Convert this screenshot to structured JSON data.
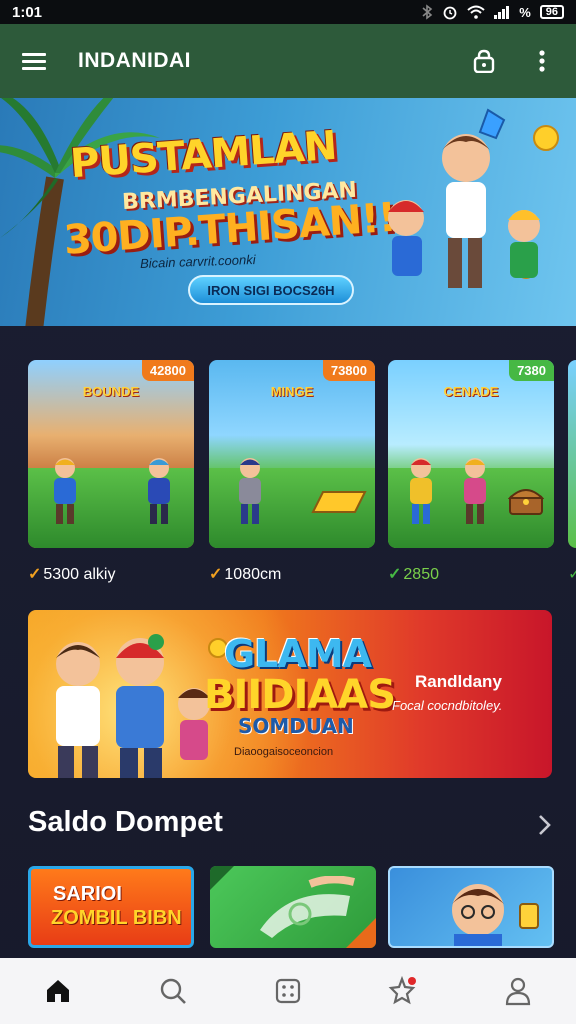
{
  "status_bar": {
    "time": "1:01",
    "battery_text": "96"
  },
  "app_bar": {
    "title": "INDANIDAI",
    "icons": [
      "menu-icon",
      "lock-icon",
      "more-vert-icon"
    ]
  },
  "hero_banner": {
    "headline_1": "PUSTAMLAN",
    "headline_2": "BRMBENGALINGAN",
    "headline_3": "30DIP.THISAN!!",
    "subtext": "Bicain carvrit.coonki",
    "cta_label": "IRON SIGI BOCS26H"
  },
  "game_cards": [
    {
      "badge": "42800",
      "mini_title": "BOUNDE",
      "price": "5300 alkiy",
      "badge_color": "#f07a1c",
      "check_color": "#f0a020"
    },
    {
      "badge": "73800",
      "mini_title": "MINGE",
      "price": "1080cm",
      "badge_color": "#f07a1c",
      "check_color": "#f0a020"
    },
    {
      "badge": "7380",
      "mini_title": "CENADE",
      "price": "2850",
      "badge_color": "#46b844",
      "check_color": "#46b844"
    }
  ],
  "promo_banner": {
    "line_1": "GLAMA",
    "line_2": "BIIDIAAS",
    "line_3": "SOMDUAN",
    "line_4": "Diaoogaisoceoncion",
    "right_title": "Randldany",
    "right_subtitle": "Focal cocndbitoley."
  },
  "section": {
    "title": "Saldo Dompet",
    "arrow_icon": "chevron-right-icon"
  },
  "wallet_tiles": [
    {
      "line_1": "SARIOI",
      "line_2": "ZOMBIL BIBN"
    },
    {
      "line_1": "",
      "line_2": ""
    },
    {
      "line_1": "",
      "line_2": ""
    }
  ],
  "bottom_nav": [
    "home-icon",
    "search-icon",
    "dice-icon",
    "star-notification-icon",
    "profile-icon"
  ],
  "colors": {
    "app_bar": "#2d5a3a",
    "background": "#171a2b",
    "bottom_nav": "#f5f5f7"
  }
}
